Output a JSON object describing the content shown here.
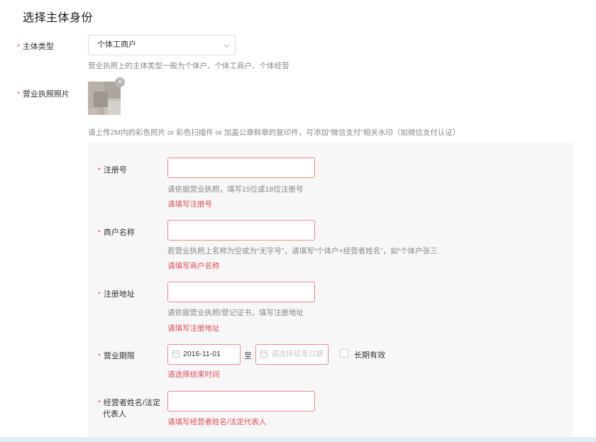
{
  "section": {
    "title": "选择主体身份"
  },
  "subject_type": {
    "label": "主体类型",
    "value": "个体工商户",
    "hint": "营业执照上的主体类型一般为个体户、个体工商户、个体经营"
  },
  "license_photo": {
    "label": "营业执照照片",
    "remove_icon": "close-icon",
    "remove_glyph": "×",
    "hint": "请上传2M内的彩色照片 or 彩色扫描件 or 加盖公章鲜章的复印件，可添加“微信支付”相关水印（如微信支付认证）"
  },
  "reg_no": {
    "label": "注册号",
    "value": "",
    "hint": "请依据营业执照，填写15位或18位注册号",
    "error": "请填写注册号"
  },
  "merchant_name": {
    "label": "商户名称",
    "value": "",
    "hint": "若营业执照上名称为空或为“无字号”，请填写“个体户+经营者姓名”，如“个体户张三",
    "error": "请填写商户名称"
  },
  "reg_address": {
    "label": "注册地址",
    "value": "",
    "hint": "请依据营业执照/登记证书，填写注册地址",
    "error": "请填写注册地址"
  },
  "business_term": {
    "label": "营业期限",
    "start_date": "2016-11-01",
    "to_label": "至",
    "end_placeholder": "请选择结束日期",
    "long_term_label": "长期有效",
    "long_term_checked": false,
    "calendar_icon": "calendar-icon",
    "error": "请选择结束时间"
  },
  "legal_rep": {
    "label_line1": "经营者姓名/法定",
    "label_line2": "代表人",
    "value": "",
    "error": "请填写经营者姓名/法定代表人"
  },
  "required_mark": "*"
}
